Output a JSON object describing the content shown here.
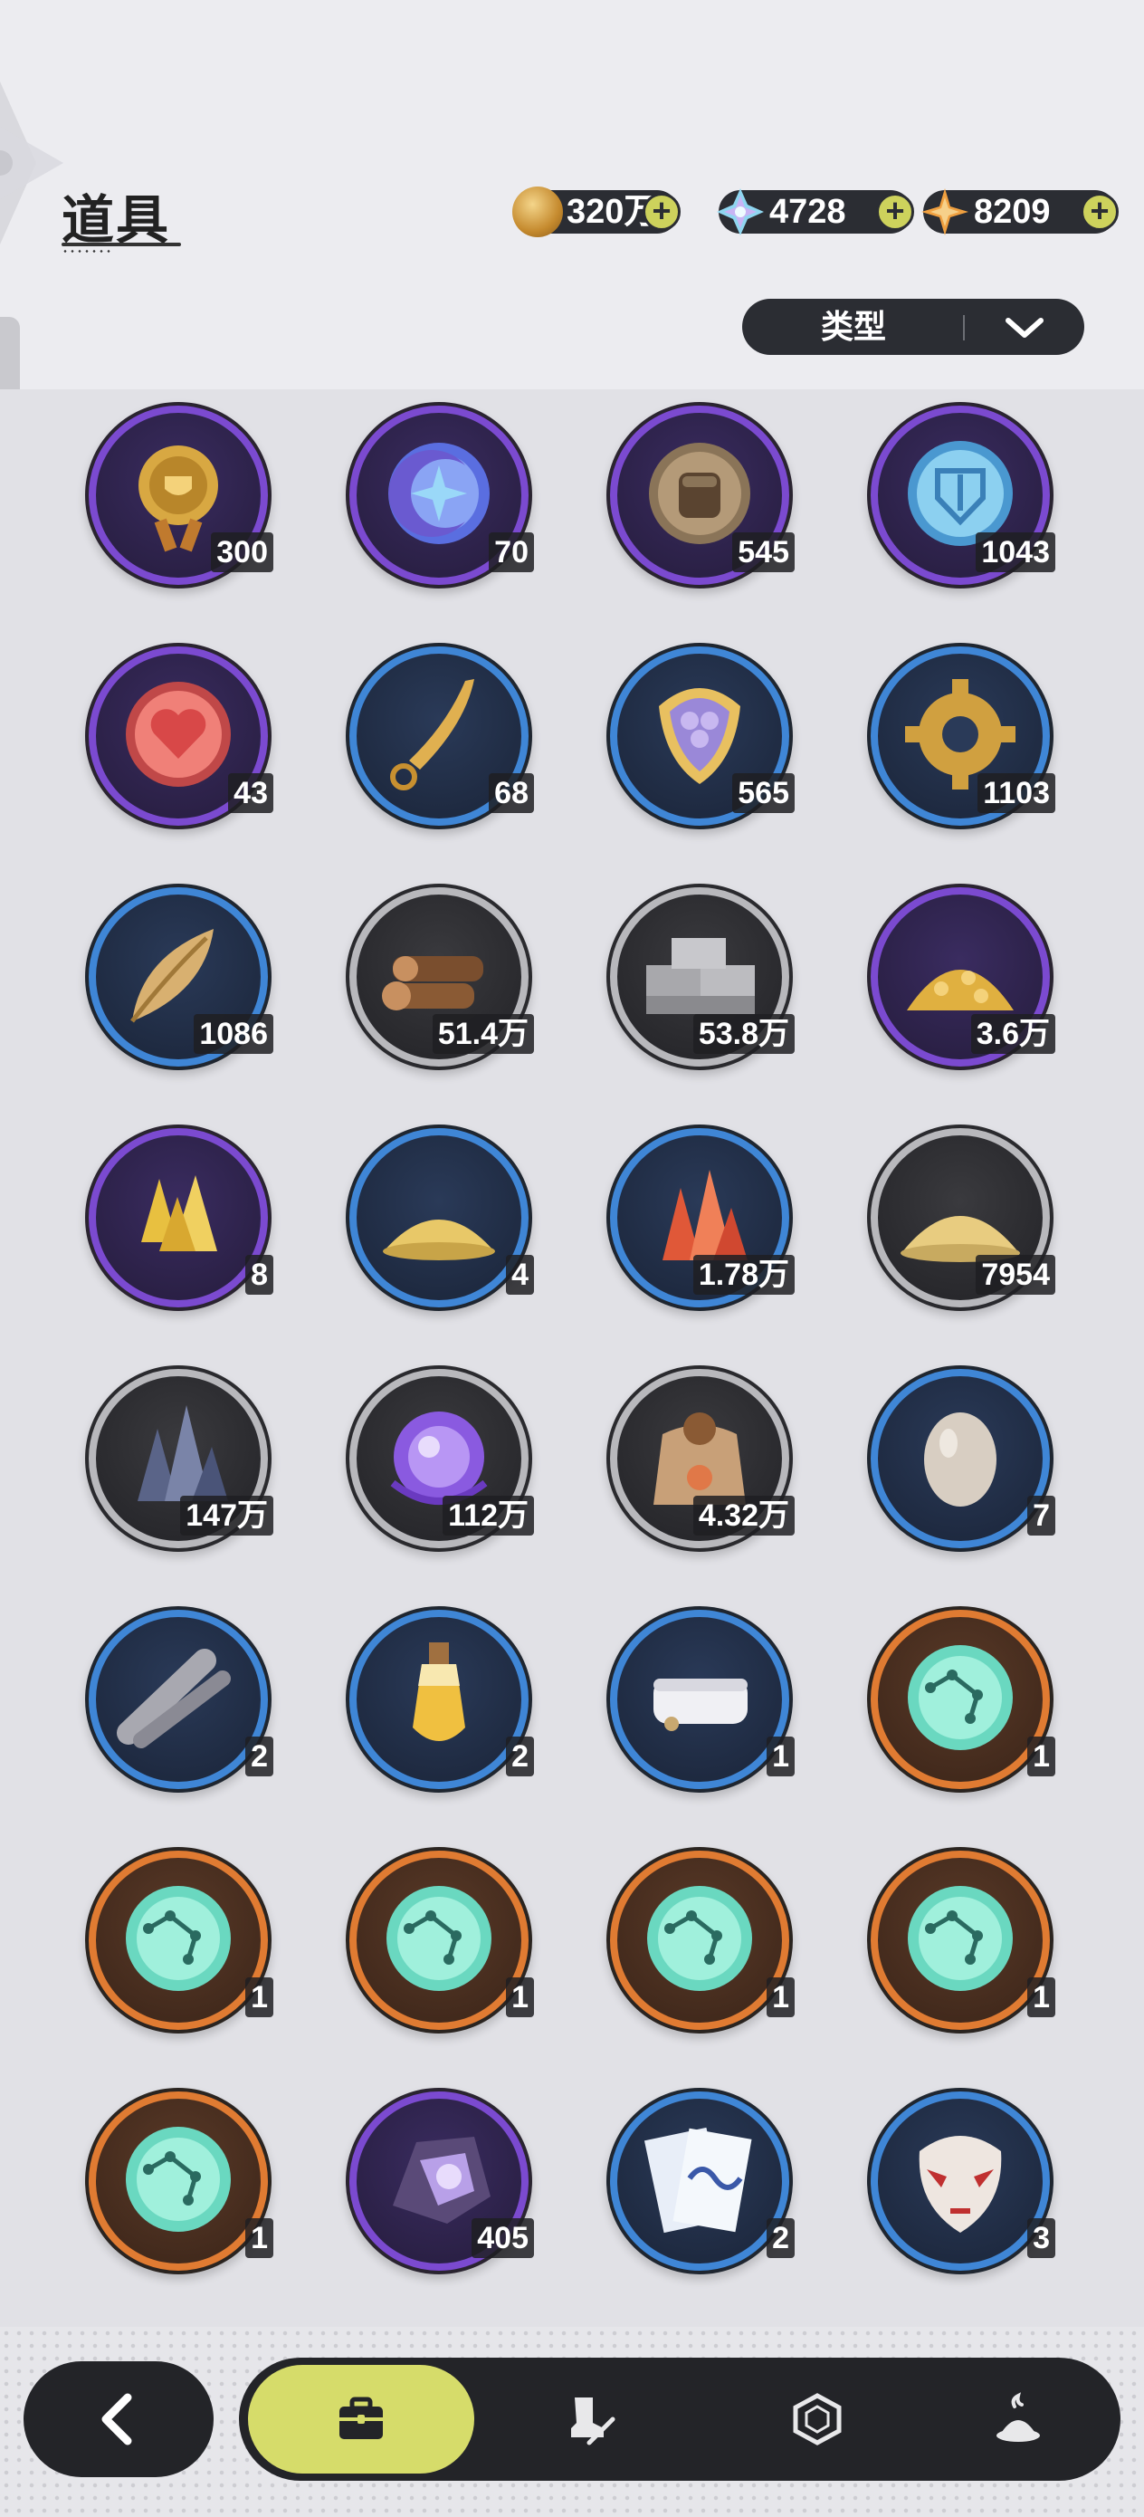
{
  "header": {
    "title": "道具",
    "currencies": [
      {
        "icon": "gold-coin-icon",
        "value": "320万"
      },
      {
        "icon": "crystal-gem-icon",
        "value": "4728"
      },
      {
        "icon": "orange-star-gem-icon",
        "value": "8209"
      }
    ],
    "add_symbol": "+"
  },
  "filter": {
    "label": "类型",
    "icon": "chevron-down-icon"
  },
  "items": [
    {
      "icon": "gold-medal-icon",
      "count": "300",
      "rarity": "purple"
    },
    {
      "icon": "star-moon-coin-icon",
      "count": "70",
      "rarity": "purple"
    },
    {
      "icon": "fist-coin-icon",
      "count": "545",
      "rarity": "purple"
    },
    {
      "icon": "blue-emblem-coin-icon",
      "count": "1043",
      "rarity": "purple"
    },
    {
      "icon": "heart-coin-icon",
      "count": "43",
      "rarity": "purple"
    },
    {
      "icon": "golden-blade-icon",
      "count": "68",
      "rarity": "blue"
    },
    {
      "icon": "scale-shield-icon",
      "count": "565",
      "rarity": "blue"
    },
    {
      "icon": "gear-icon",
      "count": "1103",
      "rarity": "blue"
    },
    {
      "icon": "golden-leaf-icon",
      "count": "1086",
      "rarity": "blue"
    },
    {
      "icon": "wood-logs-icon",
      "count": "51.4万",
      "rarity": "gray"
    },
    {
      "icon": "stone-bricks-icon",
      "count": "53.8万",
      "rarity": "gray"
    },
    {
      "icon": "gold-nugget-pile-icon",
      "count": "3.6万",
      "rarity": "purple"
    },
    {
      "icon": "gold-crystal-icon",
      "count": "8",
      "rarity": "purple"
    },
    {
      "icon": "gold-sand-pile-icon",
      "count": "4",
      "rarity": "blue"
    },
    {
      "icon": "red-crystal-icon",
      "count": "1.78万",
      "rarity": "blue"
    },
    {
      "icon": "sand-pile-icon",
      "count": "7954",
      "rarity": "gray"
    },
    {
      "icon": "dark-crystal-icon",
      "count": "147万",
      "rarity": "gray"
    },
    {
      "icon": "purple-orb-icon",
      "count": "112万",
      "rarity": "gray"
    },
    {
      "icon": "pet-food-bag-icon",
      "count": "4.32万",
      "rarity": "gray"
    },
    {
      "icon": "egg-icon",
      "count": "7",
      "rarity": "blue"
    },
    {
      "icon": "feather-bundle-icon",
      "count": "2",
      "rarity": "blue"
    },
    {
      "icon": "potion-vial-icon",
      "count": "2",
      "rarity": "blue"
    },
    {
      "icon": "towel-icon",
      "count": "1",
      "rarity": "blue"
    },
    {
      "icon": "constellation-orb-icon",
      "count": "1",
      "rarity": "orange"
    },
    {
      "icon": "constellation-orb-icon",
      "count": "1",
      "rarity": "orange"
    },
    {
      "icon": "constellation-orb-icon",
      "count": "1",
      "rarity": "orange"
    },
    {
      "icon": "constellation-orb-icon",
      "count": "1",
      "rarity": "orange"
    },
    {
      "icon": "constellation-orb-icon",
      "count": "1",
      "rarity": "orange"
    },
    {
      "icon": "constellation-orb-icon",
      "count": "1",
      "rarity": "orange"
    },
    {
      "icon": "purple-ore-icon",
      "count": "405",
      "rarity": "purple"
    },
    {
      "icon": "ticket-icon",
      "count": "2",
      "rarity": "blue"
    },
    {
      "icon": "mask-icon",
      "count": "3",
      "rarity": "blue"
    }
  ],
  "nav": {
    "back_icon": "back-arrow-icon",
    "tabs": [
      {
        "icon": "briefcase-icon",
        "active": true
      },
      {
        "icon": "boot-tool-icon",
        "active": false
      },
      {
        "icon": "hexagon-gem-icon",
        "active": false
      },
      {
        "icon": "dessert-icon",
        "active": false
      }
    ]
  },
  "colors": {
    "accent": "#d6dc6a",
    "dark_panel": "#2b2d33",
    "rarity_purple": "#7b4ad0",
    "rarity_blue": "#3f86d6",
    "rarity_gray": "#b8b8bc",
    "rarity_orange": "#e07b32"
  }
}
